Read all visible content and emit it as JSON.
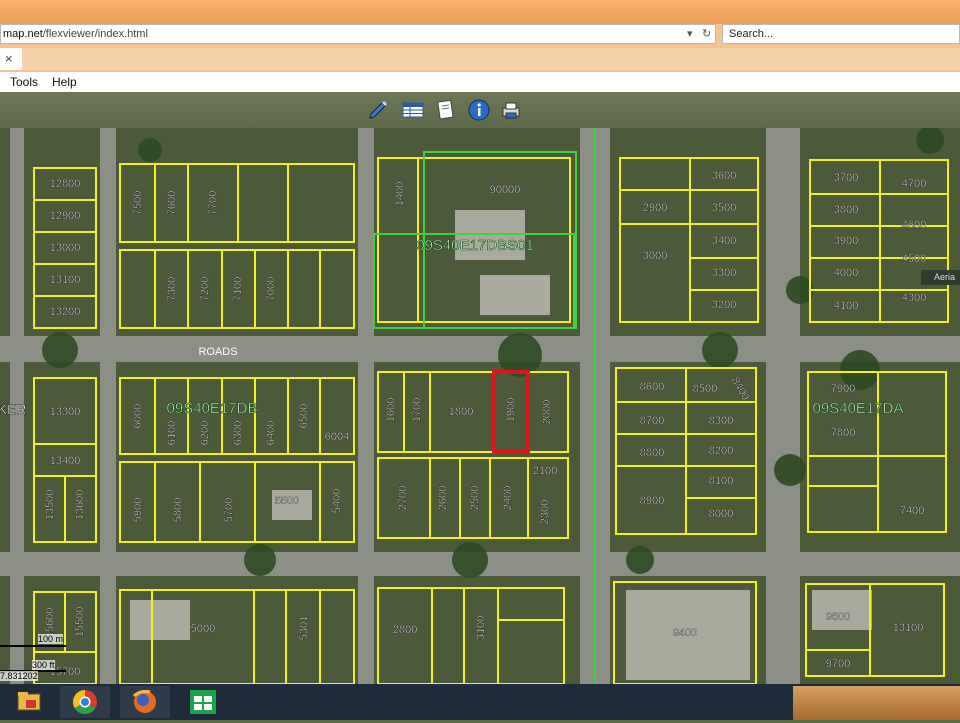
{
  "browser": {
    "url_prefix": "map.net",
    "url_rest": "/flexviewer/index.html",
    "search_placeholder": "Search...",
    "tab_close": "×",
    "menu": [
      "Tools",
      "Help"
    ]
  },
  "map": {
    "aerial_label": "Aeria",
    "road_label": "ROADS",
    "sections": [
      "09S40E17DBS01",
      "09S40E17DB",
      "09S40E17DA"
    ],
    "left_partial_label": "KER",
    "parcels": [
      "12800",
      "12900",
      "13000",
      "13100",
      "13200",
      "7500",
      "7600",
      "7700",
      "7300",
      "7200",
      "7100",
      "7000",
      "1400",
      "90000",
      "3600",
      "3500",
      "3400",
      "3300",
      "3200",
      "2900",
      "3000",
      "3700",
      "4700",
      "3800",
      "4600",
      "3900",
      "4500",
      "4000",
      "4300",
      "4100",
      "13300",
      "13400",
      "13500",
      "13600",
      "6000",
      "6100",
      "6200",
      "6300",
      "6400",
      "6500",
      "6004",
      "1600",
      "1700",
      "1800",
      "1900",
      "2000",
      "2100",
      "2700",
      "2600",
      "2500",
      "2400",
      "2300",
      "8600",
      "8500",
      "8400",
      "8700",
      "8300",
      "8800",
      "8200",
      "8100",
      "8900",
      "8000",
      "7900",
      "7800",
      "7400",
      "5900",
      "5800",
      "5700",
      "5500",
      "5400",
      "15600",
      "15500",
      "15700",
      "5000",
      "5301",
      "2800",
      "3100",
      "9400",
      "9600",
      "13100",
      "9700"
    ],
    "highlighted_parcel": "1900",
    "scale_metric": "100 m",
    "scale_imperial": "300 ft",
    "coordinate": "7.831202"
  },
  "taskbar": {
    "apps": [
      "file-explorer-icon",
      "chrome-icon",
      "firefox-icon",
      "store-icon"
    ]
  },
  "colors": {
    "parcel_line": "#f2f21a",
    "highlight": "#d9161c",
    "section_line": "#3fd23f",
    "road": "#8b8f86"
  }
}
